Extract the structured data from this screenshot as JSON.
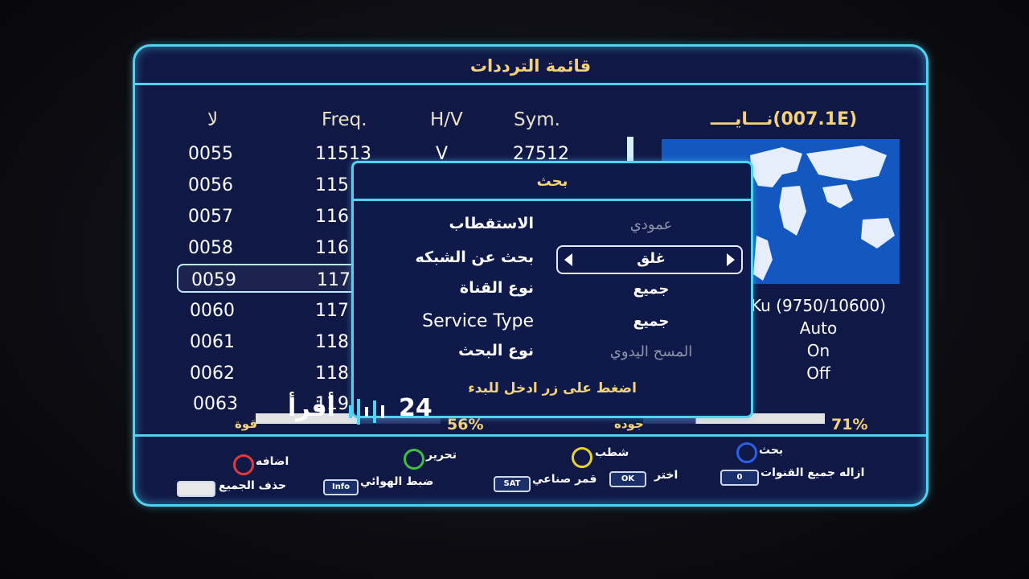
{
  "title": "قائمة الترددات",
  "columns": {
    "no": "لا",
    "freq": "Freq.",
    "hv": "H/V",
    "sym": "Sym."
  },
  "rows": [
    {
      "no": "0055",
      "freq": "11513",
      "hv": "V",
      "sym": "27512"
    },
    {
      "no": "0056",
      "freq": "115"
    },
    {
      "no": "0057",
      "freq": "116"
    },
    {
      "no": "0058",
      "freq": "116"
    },
    {
      "no": "0059",
      "freq": "117"
    },
    {
      "no": "0060",
      "freq": "117"
    },
    {
      "no": "0061",
      "freq": "118"
    },
    {
      "no": "0062",
      "freq": "118"
    },
    {
      "no": "0063",
      "freq": "119"
    }
  ],
  "selected_row_index": 4,
  "satellite": {
    "name": "نـــايــــ(007.1E)",
    "lnb": "Ku (9750/10600)",
    "line2": "Auto",
    "line3": "On",
    "line4": "Off"
  },
  "signal": {
    "strength_label": "قوة",
    "strength_pct": "56%",
    "strength_value": 0.56,
    "quality_label": "جوده",
    "quality_pct": "71%",
    "quality_value": 0.71
  },
  "legend": {
    "red": "اضافه",
    "green": "تحرير",
    "yellow": "شطب",
    "blue": "بحث",
    "delete_all": "حذف الجميع",
    "antenna": "ضبط الهوائي",
    "satellite": "قمر صناعي",
    "select": "اختر",
    "remove_all": "ازاله جميع القنوات",
    "key_info": "Info",
    "key_sat": "SAT",
    "key_ok": "OK",
    "key_zero": "0"
  },
  "dialog": {
    "title": "بحث",
    "rows": [
      {
        "label": "الاستقطاب",
        "value": "عمودي"
      },
      {
        "label": "بحث عن الشبكه",
        "value": "غلق"
      },
      {
        "label": "نوع القناة",
        "value": "جميع"
      },
      {
        "label": "Service Type",
        "value": "جميع"
      },
      {
        "label": "نوع البحث",
        "value": "المسح اليدوي"
      }
    ],
    "hint": "اضغط على زر ادخل للبدء"
  },
  "watermark": {
    "text_ar": "أقرأ",
    "text_num": "24"
  },
  "colors": {
    "frame": "#4fd3f2",
    "bg": "#101846",
    "accent": "#f4d27a",
    "map": "#1357c0"
  }
}
